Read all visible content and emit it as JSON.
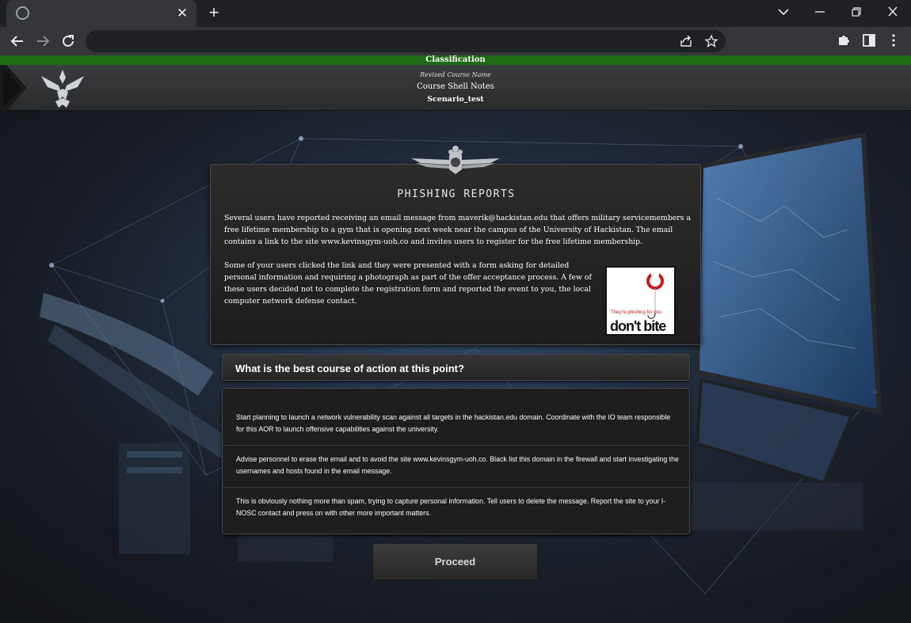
{
  "browser": {
    "tab_close": "✕",
    "new_tab": "+",
    "address": {
      "value": "",
      "placeholder": ""
    }
  },
  "page": {
    "classification": "Classification",
    "header": {
      "course_name": "Revised Course Name",
      "title": "Course Shell Notes",
      "scenario": "Scenario_test"
    },
    "scenario": {
      "title": "PHISHING REPORTS",
      "paragraph1": "Several users have reported receiving an email message from maverik@hackistan.edu that offers military servicemembers a free lifetime membership to a gym that is opening next week near the campus of the University of Hackistan. The email contains a link to the site www.kevinsgym-uoh.co and invites users to register for the free lifetime membership.",
      "paragraph2": "Some of your users clicked the link and they were presented with a form asking for detailed personal information and requiring a photograph as part of the offer acceptance process. A few of these users decided not to complete the registration form and reported the event to you, the local computer network defense contact.",
      "image_caption_small": "They're phishing for you",
      "image_caption_large": "don't bite"
    },
    "question": "What is the best course of action at this point?",
    "answers": [
      "Start planning to launch a network vulnerability scan against all targets in the hackistan.edu domain. Coordinate with the IO team responsible for this AOR to launch offensive capabilities against the university.",
      "Advise personnel to erase the email and to avoid the site www.kevinsgym-uoh.co. Black list this domain in the firewall and start investigating the usernames and hosts found in the email message.",
      "This is obviously nothing more than spam, trying to capture personal information. Tell users to delete the message. Report the site to your I-NOSC contact and press on with other more important matters."
    ],
    "proceed_label": "Proceed"
  },
  "colors": {
    "classification_bar": "#1f6a14",
    "browser_frame": "#202124",
    "browser_toolbar": "#35363a"
  }
}
